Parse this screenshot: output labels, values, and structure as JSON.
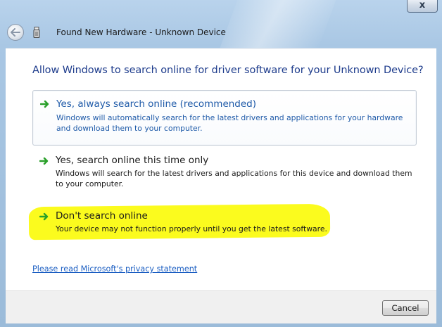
{
  "window": {
    "title": "Found New Hardware - Unknown Device",
    "close_glyph": "x"
  },
  "content": {
    "heading": "Allow Windows to search online for driver software for your Unknown Device?",
    "options": [
      {
        "title": "Yes, always search online (recommended)",
        "description": "Windows will automatically search for the latest drivers and applications for your hardware and download them to your computer.",
        "icon": "green-arrow-icon",
        "selected": true
      },
      {
        "title": "Yes, search online this time only",
        "description": "Windows will search for the latest drivers and applications for this device and download them to your computer.",
        "icon": "green-arrow-icon",
        "selected": false
      },
      {
        "title": "Don't search online",
        "description": "Your device may not function properly until you get the latest software.",
        "icon": "green-arrow-icon",
        "selected": false,
        "highlighted": true
      }
    ],
    "privacy_link": "Please read Microsoft's  privacy statement"
  },
  "footer": {
    "cancel_label": "Cancel"
  },
  "colors": {
    "heading": "#1e3c8c",
    "link": "#1b5ec2",
    "highlight": "#fbfb1e",
    "arrow": "#2aa02a"
  }
}
